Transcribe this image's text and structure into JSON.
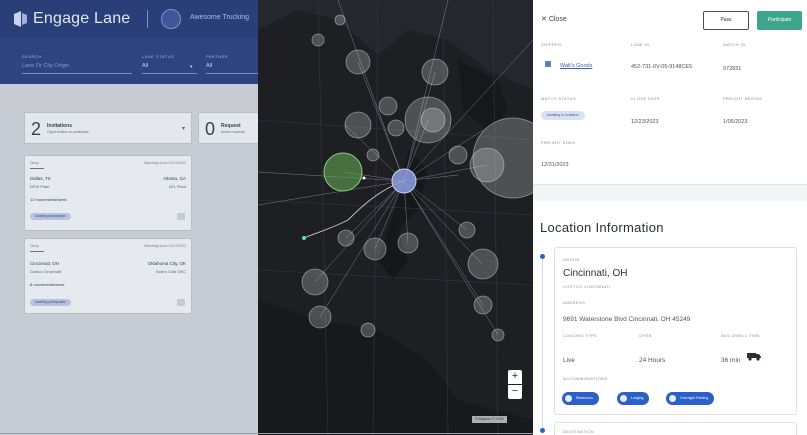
{
  "header": {
    "brand": "Engage Lane",
    "org_name": "Awesome Trucking"
  },
  "filters": [
    {
      "label": "Search",
      "value": "Lane Or City Origin"
    },
    {
      "label": "Lane Status",
      "value": "All"
    },
    {
      "label": "Partner",
      "value": "All"
    }
  ],
  "summary": [
    {
      "count": "2",
      "title": "Invitations",
      "subtitle": "Opportunities to participate"
    },
    {
      "count": "0",
      "title": "Request",
      "subtitle": "Active requests"
    }
  ],
  "lane_cards": [
    {
      "header": "Cincy",
      "header_right": "Watching since 12/01/2023",
      "origin": "Dallas, TX",
      "dest": "Atlanta, GA",
      "origin_sub": "DFW Plant",
      "dest_sub": "ATL Plant",
      "loads": "12 movements/week",
      "status": "Awaiting participation"
    },
    {
      "header": "Cincy",
      "header_right": "Watching since 12/01/2023",
      "origin": "Cincinnati, OH",
      "dest": "Oklahoma City, OK",
      "origin_sub": "Costco Cincinnati",
      "dest_sub": "Sam's Club OKC",
      "loads": "8 movements/week",
      "status": "Awaiting participation"
    }
  ],
  "map": {
    "zoom_in": "+",
    "zoom_out": "−",
    "attribution": "© Mapbox  © OSM"
  },
  "panel": {
    "close_label": "Close",
    "pass_label": "Pass",
    "participate_label": "Participate",
    "fields": {
      "shipper_label": "Shipper",
      "shipper_value": "Walt's Goods",
      "lane_id_label": "Lane ID",
      "lane_id_value": "452-731-0V-05-9148CE5",
      "watch_id_label": "Watch ID",
      "watch_id_value": "972831",
      "match_status_label": "Match Status",
      "match_status_value": "Awaiting to Invitation",
      "close_date_label": "Close Date",
      "close_date_value": "12/23/2023",
      "freight_begins_label": "Freight Begins",
      "freight_begins_value": "1/05/2023",
      "freight_ends_label": "Freight Ends",
      "freight_ends_value": "12/31/2023"
    },
    "location_title": "Location Information",
    "origin": {
      "label": "Origin",
      "city": "Cincinnati, OH",
      "facility": "Costco Cincinnati",
      "address_label": "Address",
      "address": "9691 Waterstone Blvd Cincinnati, OH 45249",
      "loading_type_label": "Loading Type",
      "loading_type": "Live",
      "hours_label": "Open",
      "hours": "24 Hours",
      "dwell_label": "Avg Dwell Time",
      "dwell": "36 min",
      "accommodations_label": "Accommodations",
      "chips": [
        "Restrooms",
        "Lodging",
        "Overnight Parking"
      ]
    },
    "destination": {
      "label": "Destination"
    }
  },
  "colors": {
    "brand_navy": "#2a3f78",
    "accent_green": "#3ea58c",
    "accent_blue": "#2b5fc9",
    "map_bg": "#1d1f23"
  }
}
